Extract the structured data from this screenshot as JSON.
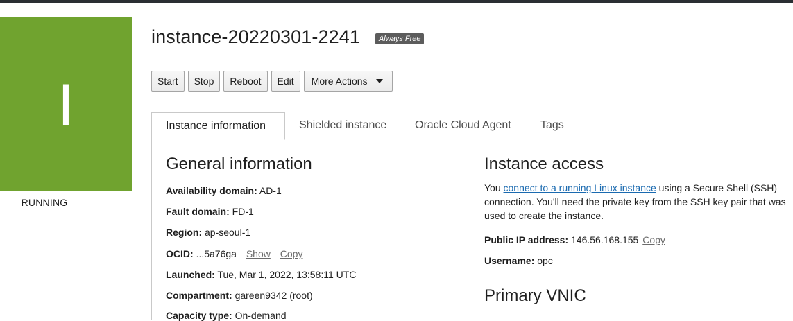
{
  "instance": {
    "status_letter": "I",
    "status": "RUNNING",
    "name": "instance-20220301-2241",
    "badge": "Always Free"
  },
  "actions": {
    "start": "Start",
    "stop": "Stop",
    "reboot": "Reboot",
    "edit": "Edit",
    "more": "More Actions"
  },
  "tabs": [
    {
      "label": "Instance information",
      "active": true
    },
    {
      "label": "Shielded instance",
      "active": false
    },
    {
      "label": "Oracle Cloud Agent",
      "active": false
    },
    {
      "label": "Tags",
      "active": false
    }
  ],
  "general": {
    "title": "General information",
    "availability_domain": {
      "label": "Availability domain:",
      "value": "AD-1"
    },
    "fault_domain": {
      "label": "Fault domain:",
      "value": "FD-1"
    },
    "region": {
      "label": "Region:",
      "value": "ap-seoul-1"
    },
    "ocid": {
      "label": "OCID:",
      "value": "...5a76ga",
      "show": "Show",
      "copy": "Copy"
    },
    "launched": {
      "label": "Launched:",
      "value": "Tue, Mar 1, 2022, 13:58:11 UTC"
    },
    "compartment": {
      "label": "Compartment:",
      "value": "gareen9342 (root)"
    },
    "capacity_type": {
      "label": "Capacity type:",
      "value": "On-demand"
    }
  },
  "access": {
    "title": "Instance access",
    "text_before": "You ",
    "link": "connect to a running Linux instance",
    "text_after": " using a Secure Shell (SSH) connection. You'll need the private key from the SSH key pair that was used to create the instance.",
    "public_ip": {
      "label": "Public IP address:",
      "value": "146.56.168.155",
      "copy": "Copy"
    },
    "username": {
      "label": "Username:",
      "value": "opc"
    }
  },
  "vnic": {
    "title": "Primary VNIC"
  },
  "colors": {
    "status_tile": "#70a32f",
    "link_blue": "#1a6ab0",
    "badge_bg": "#5c5c5c"
  }
}
